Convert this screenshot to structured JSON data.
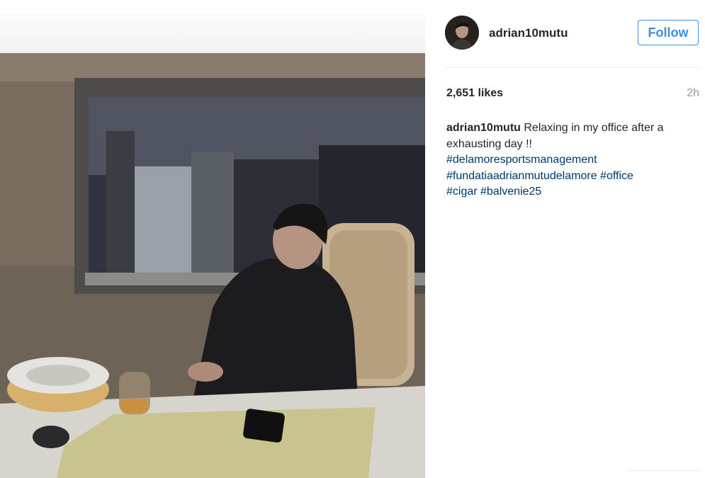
{
  "post": {
    "username": "adrian10mutu",
    "follow_label": "Follow",
    "likes": "2,651 likes",
    "time_ago": "2h",
    "caption_user": "adrian10mutu",
    "caption_text": "Relaxing in my office after a exhausting day !!",
    "hashtags": [
      "#delamoresportsmanagement",
      "#fundatiaadrianmutudelamore",
      "#office",
      "#cigar",
      "#balvenie25"
    ]
  },
  "colors": {
    "link": "#00376b",
    "follow": "#3f8ddf",
    "muted": "#999999"
  }
}
